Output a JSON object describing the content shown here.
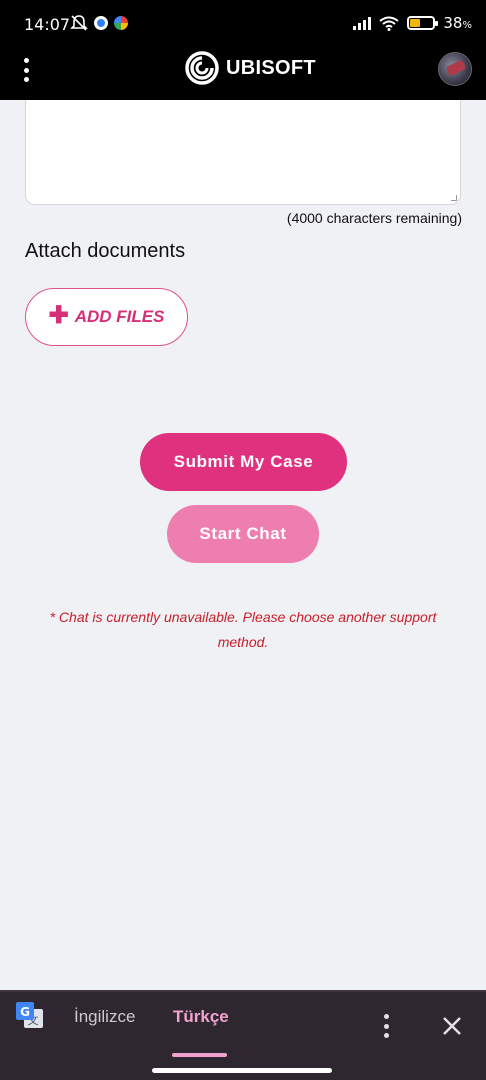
{
  "status_bar": {
    "time": "14:07",
    "battery_percent": "38",
    "battery_unit": "%",
    "battery_level": 0.38,
    "battery_color": "#f2b705"
  },
  "header": {
    "brand_name": "UBISOFT",
    "menu_icon": "vertical-dots-icon",
    "avatar_icon": "user-avatar"
  },
  "form": {
    "characters_remaining": "(4000 characters remaining)",
    "attach_heading": "Attach documents",
    "add_files_label": "ADD FILES",
    "submit_label": "Submit My Case",
    "start_chat_label": "Start Chat",
    "chat_unavailable_note": "* Chat is currently unavailable. Please choose another support method."
  },
  "translate_bar": {
    "source_language": "İngilizce",
    "target_language": "Türkçe",
    "more_icon": "vertical-dots-icon",
    "close_icon": "close-icon"
  },
  "colors": {
    "accent": "#e0317f",
    "accent_disabled": "#ee7db0",
    "error_text": "#c81e2b",
    "translate_highlight": "#f0a3cf"
  }
}
